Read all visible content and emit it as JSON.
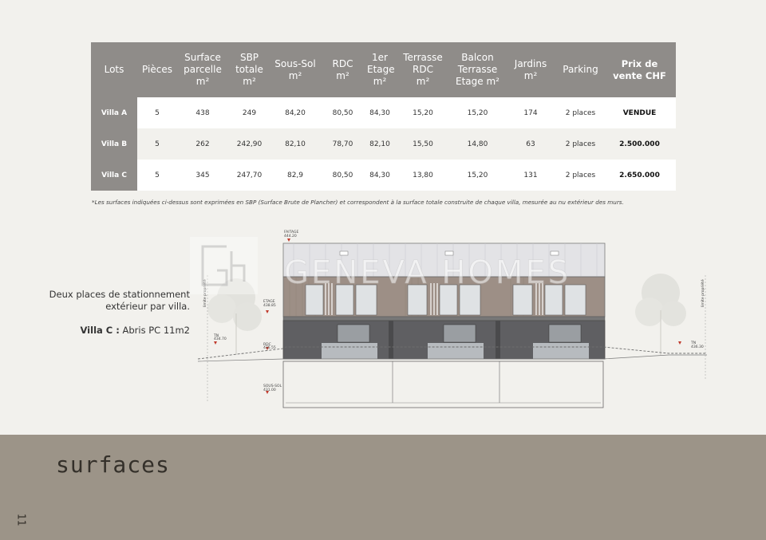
{
  "table": {
    "headers": [
      "Lots",
      "Pièces",
      "Surface\nparcelle\nm²",
      "SBP\ntotale\nm²",
      "Sous-Sol\nm²",
      "RDC\nm²",
      "1er\nEtage\nm²",
      "Terrasse\nRDC\nm²",
      "Balcon\nTerrasse\nEtage m²",
      "Jardins\nm²",
      "Parking",
      "Prix de\nvente CHF"
    ],
    "rows": [
      [
        "Villa A",
        "5",
        "438",
        "249",
        "84,20",
        "80,50",
        "84,30",
        "15,20",
        "15,20",
        "174",
        "2 places",
        "VENDUE"
      ],
      [
        "Villa B",
        "5",
        "262",
        "242,90",
        "82,10",
        "78,70",
        "82,10",
        "15,50",
        "14,80",
        "63",
        "2 places",
        "2.500.000"
      ],
      [
        "Villa C",
        "5",
        "345",
        "247,70",
        "82,9",
        "80,50",
        "84,30",
        "13,80",
        "15,20",
        "131",
        "2 places",
        "2.650.000"
      ]
    ]
  },
  "note": "*Les surfaces indiquées ci-dessus sont exprimées en SBP (Surface Brute de Plancher) et correspondent à la surface totale construite de chaque villa, mesurée au nu extérieur des murs.",
  "side": {
    "parking_text": "Deux places de stationnement extérieur par villa.",
    "villa_label": "Villa C :",
    "villa_text": " Abris PC 11m2"
  },
  "drawing": {
    "watermark": "GENEVA HOMES",
    "levels": {
      "faitage": "FAITAGE",
      "faitage_alt": "444.20",
      "etage": "ETAGE",
      "etage_alt": "438.85",
      "rdc": "RDC",
      "rdc_alt": "435.55",
      "sous_sol": "SOUS-SOL",
      "sous_sol_alt": "431.00",
      "tn_left": "TN",
      "tn_left_alt": "434.70",
      "tn_right": "TN",
      "tn_right_alt": "436.30",
      "limite_left": "limite propriété",
      "limite_right": "limite propriété"
    }
  },
  "footer": {
    "title": "surfaces",
    "page_number": "11"
  },
  "colors": {
    "header_bg": "#8f8c89",
    "band_bg": "#9c9488",
    "page_bg": "#f2f1ed"
  }
}
